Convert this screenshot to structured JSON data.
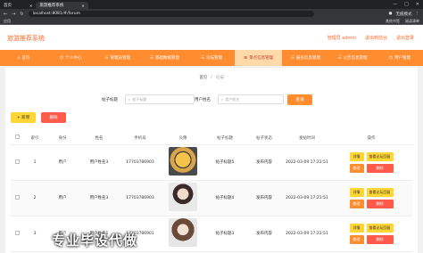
{
  "browser": {
    "tabs": [
      {
        "label": "首页"
      },
      {
        "label": "旅游推荐系统"
      }
    ],
    "url": "localhost:8081/#/forum",
    "profile_label": "无痕模式",
    "bookmarks": [
      "应用"
    ],
    "bookmarks_right": [
      "其他书签",
      "阅读清单"
    ]
  },
  "header": {
    "site_title": "旅游推荐系统",
    "admin_label": "管理员 admin",
    "logout_label": "退出到前台",
    "exit_label": "退出登录"
  },
  "nav": {
    "items": [
      {
        "label": "首页"
      },
      {
        "label": "个人中心"
      },
      {
        "label": "管理员管理"
      },
      {
        "label": "基础数据管理"
      },
      {
        "label": "论坛管理"
      },
      {
        "label": "景点信息管理"
      },
      {
        "label": "报名信息管理"
      },
      {
        "label": "公告信息管理"
      },
      {
        "label": "用户管理"
      }
    ]
  },
  "breadcrumb": {
    "home": "首页",
    "sep": "/",
    "current": "论坛"
  },
  "search": {
    "title_label": "帖子标题",
    "title_placeholder": "帖子标题",
    "user_label": "用户姓名",
    "user_placeholder": "用户姓名",
    "button": "查询"
  },
  "actions": {
    "add": "+ 新增",
    "delete": "删除"
  },
  "table": {
    "headers": [
      "",
      "索引",
      "身份",
      "姓名",
      "手机号",
      "头像",
      "帖子标题",
      "帖子状态",
      "发帖时间",
      "操作"
    ],
    "rows": [
      {
        "index": "1",
        "role": "用户",
        "name": "用户姓名3",
        "phone": "17703786903",
        "title": "帖子标题5",
        "status": "发布内容",
        "time": "2022-03-09 17:23:51"
      },
      {
        "index": "2",
        "role": "用户",
        "name": "用户姓名3",
        "phone": "17703786903",
        "title": "帖子标题4",
        "status": "发布内容",
        "time": "2022-03-09 17:23:51"
      },
      {
        "index": "3",
        "role": "用户",
        "name": "用户姓名1",
        "phone": "17703786901",
        "title": "帖子标题3",
        "status": "发布内容",
        "time": "2022-03-09 17:23:51"
      }
    ],
    "op_labels": {
      "detail": "详情",
      "reply": "查看论坛回复",
      "edit": "修改",
      "del": "删除"
    }
  },
  "watermark": "专业毕设代做"
}
